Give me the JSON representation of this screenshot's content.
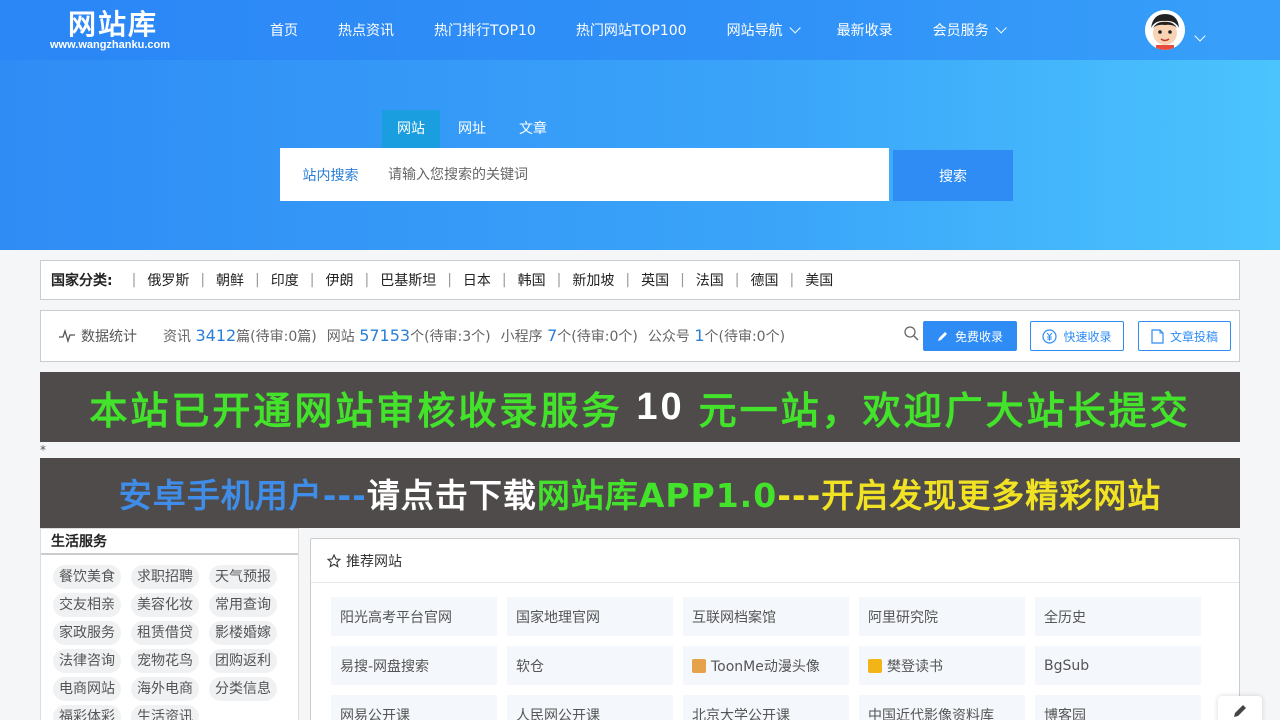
{
  "header": {
    "logo_text": "网站库",
    "logo_domain": "www.wangzhanku.com",
    "nav": [
      {
        "label": "首页",
        "has_dropdown": false
      },
      {
        "label": "热点资讯",
        "has_dropdown": false
      },
      {
        "label": "热门排行TOP10",
        "has_dropdown": false
      },
      {
        "label": "热门网站TOP100",
        "has_dropdown": false
      },
      {
        "label": "网站导航",
        "has_dropdown": true
      },
      {
        "label": "最新收录",
        "has_dropdown": false
      },
      {
        "label": "会员服务",
        "has_dropdown": true
      }
    ]
  },
  "search": {
    "tabs": [
      "网站",
      "网址",
      "文章"
    ],
    "active_tab": 0,
    "scope_label": "站内搜索",
    "placeholder": "请输入您搜索的关键词",
    "value": "",
    "button_label": "搜索"
  },
  "countries": {
    "label": "国家分类:",
    "items": [
      "俄罗斯",
      "朝鲜",
      "印度",
      "伊朗",
      "巴基斯坦",
      "日本",
      "韩国",
      "新加坡",
      "英国",
      "法国",
      "德国",
      "美国"
    ]
  },
  "stats": {
    "title": "数据统计",
    "items": [
      {
        "prefix": "资讯",
        "count": "3412",
        "suffix": "篇(待审:0篇)"
      },
      {
        "prefix": "网站",
        "count": "57153",
        "suffix": "个(待审:3个)"
      },
      {
        "prefix": "小程序",
        "count": "7",
        "suffix": "个(待审:0个)"
      },
      {
        "prefix": "公众号",
        "count": "1",
        "suffix": "个(待审:0个)"
      }
    ],
    "buttons": {
      "free": "免费收录",
      "fast": "快速收录",
      "post": "文章投稿"
    }
  },
  "banners": {
    "banner1": {
      "part1": "本站已开通网站审核收录服务",
      "part2": "10",
      "part3": "元一站，欢迎广大站长提交"
    },
    "separator": "*",
    "banner2": {
      "part1": "安卓手机用户---",
      "part2": "请点击下载",
      "part3": "网站库APP1.0",
      "part4": "---开启发现更多精彩网站"
    }
  },
  "sidebar": {
    "title": "生活服务",
    "tags": [
      "餐饮美食",
      "求职招聘",
      "天气预报",
      "交友相亲",
      "美容化妆",
      "常用查询",
      "家政服务",
      "租赁借贷",
      "影楼婚嫁",
      "法律咨询",
      "宠物花鸟",
      "团购返利",
      "电商网站",
      "海外电商",
      "分类信息",
      "福彩体彩",
      "生活资讯"
    ]
  },
  "recommended": {
    "title": "推荐网站",
    "sites": [
      {
        "name": "阳光高考平台官网",
        "fav": ""
      },
      {
        "name": "国家地理官网",
        "fav": ""
      },
      {
        "name": "互联网档案馆",
        "fav": ""
      },
      {
        "name": "阿里研究院",
        "fav": ""
      },
      {
        "name": "全历史",
        "fav": ""
      },
      {
        "name": "易搜-网盘搜索",
        "fav": ""
      },
      {
        "name": "软仓",
        "fav": ""
      },
      {
        "name": "ToonMe动漫头像",
        "fav": "#e6a24a"
      },
      {
        "name": "樊登读书",
        "fav": "#f2b416"
      },
      {
        "name": "BgSub",
        "fav": ""
      },
      {
        "name": "网易公开课",
        "fav": ""
      },
      {
        "name": "人民网公开课",
        "fav": ""
      },
      {
        "name": "北京大学公开课",
        "fav": ""
      },
      {
        "name": "中国近代影像资料库",
        "fav": ""
      },
      {
        "name": "博客园",
        "fav": ""
      }
    ]
  },
  "colors": {
    "accent": "#2f8cf5",
    "link": "#2a7ed8",
    "banner_bg": "#4f4b4a"
  }
}
